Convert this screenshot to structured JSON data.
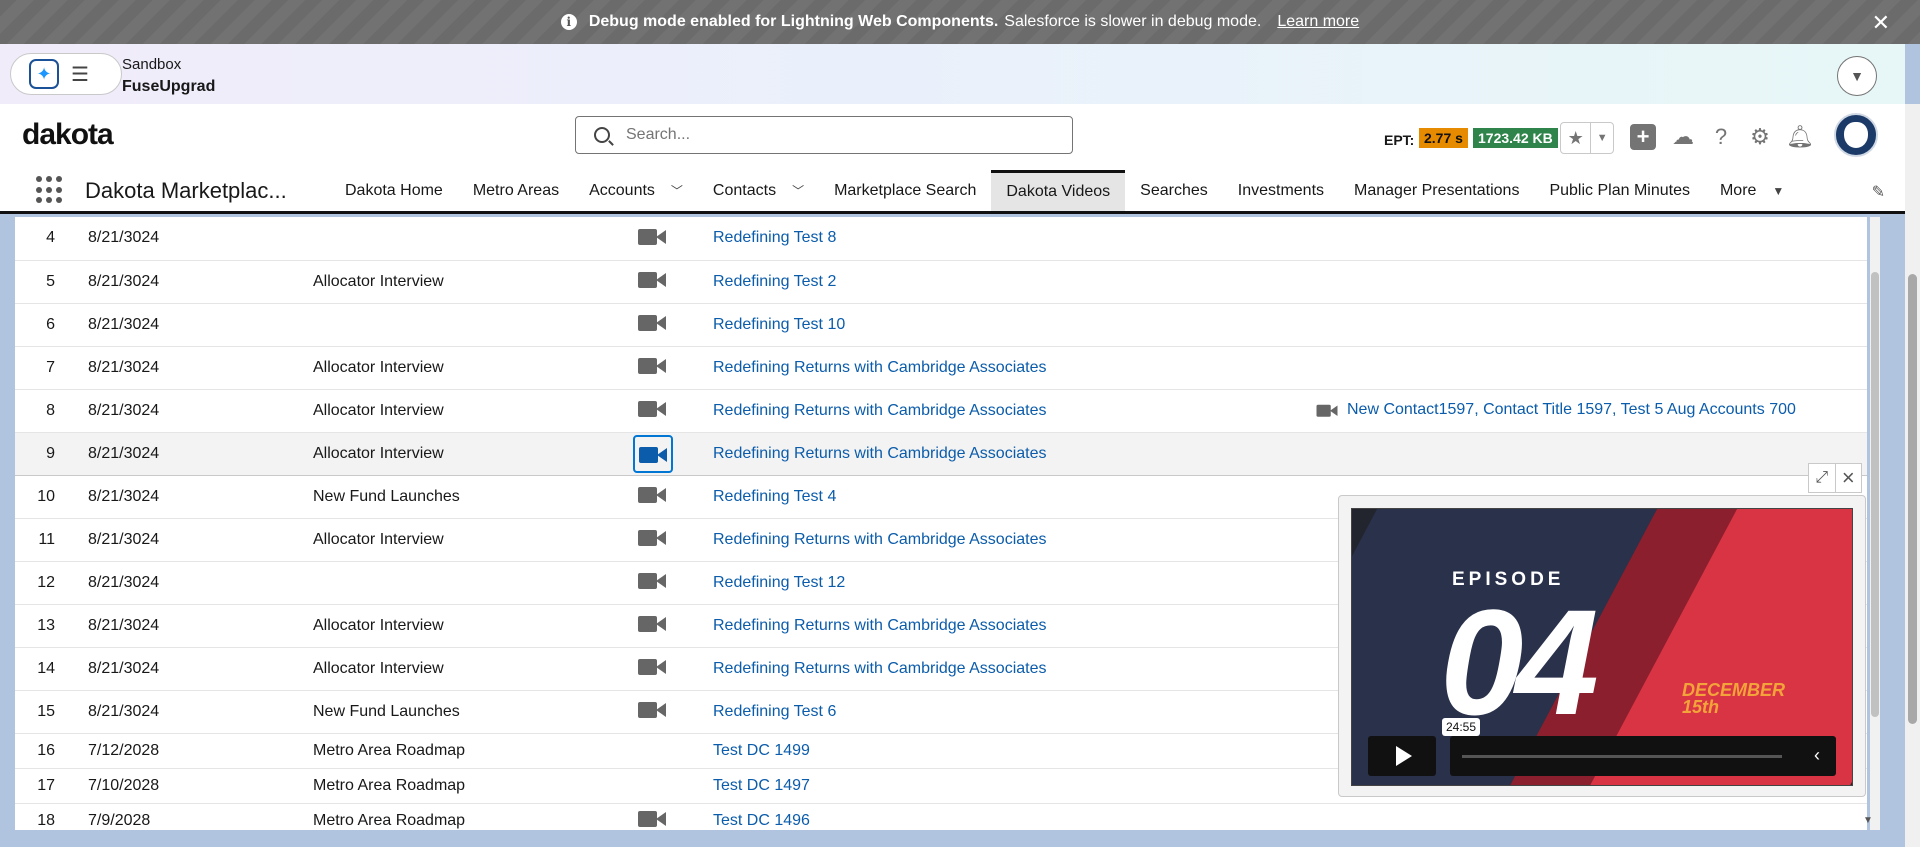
{
  "banner": {
    "bold": "Debug mode enabled for Lightning Web Components.",
    "text": "Salesforce is slower in debug mode.",
    "link": "Learn more",
    "close": "✕"
  },
  "sandbox": {
    "label": "Sandbox",
    "org": "FuseUpgrad"
  },
  "header": {
    "logo": "dakota",
    "search_placeholder": "Search...",
    "ept_label": "EPT:",
    "ept_time": "2.77 s",
    "ept_size": "1723.42 KB"
  },
  "nav": {
    "app_name": "Dakota Marketplac...",
    "tabs": [
      {
        "label": "Dakota Home"
      },
      {
        "label": "Metro Areas"
      },
      {
        "label": "Accounts"
      },
      {
        "label": "Contacts"
      },
      {
        "label": "Marketplace Search"
      },
      {
        "label": "Dakota Videos"
      },
      {
        "label": "Searches"
      },
      {
        "label": "Investments"
      },
      {
        "label": "Manager Presentations"
      },
      {
        "label": "Public Plan Minutes"
      },
      {
        "label": "More"
      }
    ]
  },
  "rows": [
    {
      "num": "4",
      "date": "8/21/3024",
      "type": "",
      "video": true,
      "title": "Redefining Test 8",
      "related": ""
    },
    {
      "num": "5",
      "date": "8/21/3024",
      "type": "Allocator Interview",
      "video": true,
      "title": "Redefining Test 2",
      "related": ""
    },
    {
      "num": "6",
      "date": "8/21/3024",
      "type": "",
      "video": true,
      "title": "Redefining Test 10",
      "related": ""
    },
    {
      "num": "7",
      "date": "8/21/3024",
      "type": "Allocator Interview",
      "video": true,
      "title": "Redefining Returns with Cambridge Associates",
      "related": ""
    },
    {
      "num": "8",
      "date": "8/21/3024",
      "type": "Allocator Interview",
      "video": true,
      "title": "Redefining Returns with Cambridge Associates",
      "related": "New Contact1597, Contact Title 1597, Test 5 Aug Accounts 700"
    },
    {
      "num": "9",
      "date": "8/21/3024",
      "type": "Allocator Interview",
      "video": true,
      "title": "Redefining Returns with Cambridge Associates",
      "related": ""
    },
    {
      "num": "10",
      "date": "8/21/3024",
      "type": "New Fund Launches",
      "video": true,
      "title": "Redefining Test 4",
      "related": ""
    },
    {
      "num": "11",
      "date": "8/21/3024",
      "type": "Allocator Interview",
      "video": true,
      "title": "Redefining Returns with Cambridge Associates",
      "related": ""
    },
    {
      "num": "12",
      "date": "8/21/3024",
      "type": "",
      "video": true,
      "title": "Redefining Test 12",
      "related": ""
    },
    {
      "num": "13",
      "date": "8/21/3024",
      "type": "Allocator Interview",
      "video": true,
      "title": "Redefining Returns with Cambridge Associates",
      "related": ""
    },
    {
      "num": "14",
      "date": "8/21/3024",
      "type": "Allocator Interview",
      "video": true,
      "title": "Redefining Returns with Cambridge Associates",
      "related": ""
    },
    {
      "num": "15",
      "date": "8/21/3024",
      "type": "New Fund Launches",
      "video": true,
      "title": "Redefining Test 6",
      "related": ""
    },
    {
      "num": "16",
      "date": "7/12/2028",
      "type": "Metro Area Roadmap",
      "video": false,
      "title": "Test DC 1499",
      "related": ""
    },
    {
      "num": "17",
      "date": "7/10/2028",
      "type": "Metro Area Roadmap",
      "video": false,
      "title": "Test DC 1497",
      "related": ""
    },
    {
      "num": "18",
      "date": "7/9/2028",
      "type": "Metro Area Roadmap",
      "video": true,
      "title": "Test DC 1496",
      "related": ""
    }
  ],
  "player": {
    "episode_label": "EPISODE",
    "episode_number": "04",
    "date_line1": "DECEMBER",
    "date_line2": "15th",
    "time": "24:55"
  }
}
